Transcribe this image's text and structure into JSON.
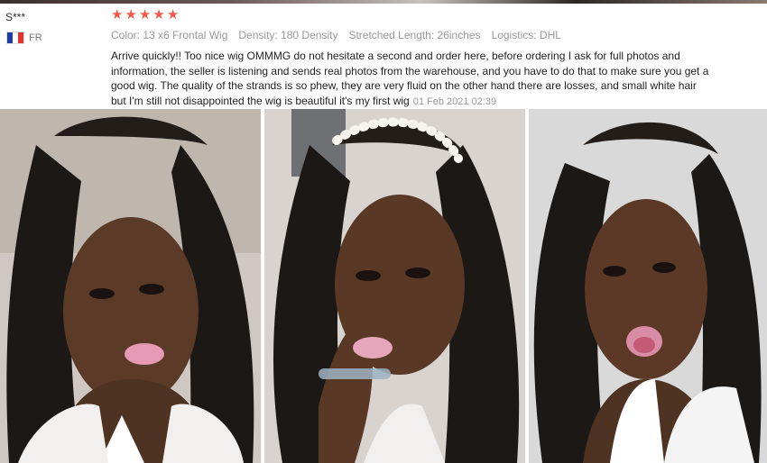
{
  "review": {
    "reviewer": "S***",
    "country": "FR",
    "rating": 5,
    "attributes": [
      "Color: 13 x6 Frontal Wig",
      "Density: 180 Density",
      "Stretched Length: 26inches",
      "Logistics: DHL"
    ],
    "text": "Arrive quickly!! Too nice wig OMMMG do not hesitate a second and order here, before ordering I ask for full photos and information, the seller is listening and sends real photos from the warehouse, and you have to do that to make sure you get a good wig. The quality of the strands is so phew, they are very fluid on the other hand there are losses, and small white hair but I'm still not disappointed the wig is beautiful it's my first wig",
    "date": "01 Feb 2021 02:39"
  },
  "colors": {
    "star": "#f05a4a",
    "flag_blue": "#1f3fa0",
    "flag_white": "#ffffff",
    "flag_red": "#e2342f"
  },
  "photos": [
    {
      "icon": "review-photo-1"
    },
    {
      "icon": "review-photo-2"
    },
    {
      "icon": "review-photo-3"
    }
  ]
}
